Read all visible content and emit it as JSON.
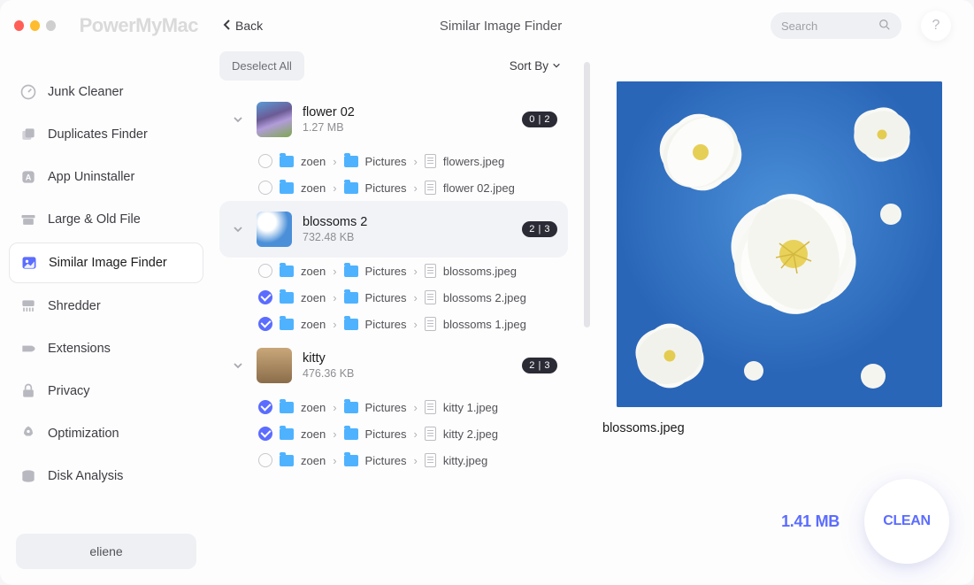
{
  "app_name": "PowerMyMac",
  "back_label": "Back",
  "page_title": "Similar Image Finder",
  "search_placeholder": "Search",
  "help_label": "?",
  "sidebar": {
    "items": [
      {
        "label": "Junk Cleaner"
      },
      {
        "label": "Duplicates Finder"
      },
      {
        "label": "App Uninstaller"
      },
      {
        "label": "Large & Old File"
      },
      {
        "label": "Similar Image Finder"
      },
      {
        "label": "Shredder"
      },
      {
        "label": "Extensions"
      },
      {
        "label": "Privacy"
      },
      {
        "label": "Optimization"
      },
      {
        "label": "Disk Analysis"
      }
    ],
    "user": "eliene"
  },
  "toolbar": {
    "deselect_label": "Deselect All",
    "sort_label": "Sort By"
  },
  "groups": [
    {
      "name": "flower 02",
      "size": "1.27 MB",
      "badge": "0 | 2",
      "files": [
        {
          "checked": false,
          "path": [
            "zoen",
            "Pictures"
          ],
          "file": "flowers.jpeg"
        },
        {
          "checked": false,
          "path": [
            "zoen",
            "Pictures"
          ],
          "file": "flower 02.jpeg"
        }
      ]
    },
    {
      "name": "blossoms 2",
      "size": "732.48 KB",
      "badge": "2 | 3",
      "files": [
        {
          "checked": false,
          "path": [
            "zoen",
            "Pictures"
          ],
          "file": "blossoms.jpeg"
        },
        {
          "checked": true,
          "path": [
            "zoen",
            "Pictures"
          ],
          "file": "blossoms 2.jpeg"
        },
        {
          "checked": true,
          "path": [
            "zoen",
            "Pictures"
          ],
          "file": "blossoms 1.jpeg"
        }
      ]
    },
    {
      "name": "kitty",
      "size": "476.36 KB",
      "badge": "2 | 3",
      "files": [
        {
          "checked": true,
          "path": [
            "zoen",
            "Pictures"
          ],
          "file": "kitty 1.jpeg"
        },
        {
          "checked": true,
          "path": [
            "zoen",
            "Pictures"
          ],
          "file": "kitty 2.jpeg"
        },
        {
          "checked": false,
          "path": [
            "zoen",
            "Pictures"
          ],
          "file": "kitty.jpeg"
        }
      ]
    }
  ],
  "preview": {
    "filename": "blossoms.jpeg"
  },
  "footer": {
    "total_size": "1.41 MB",
    "clean_label": "CLEAN"
  }
}
